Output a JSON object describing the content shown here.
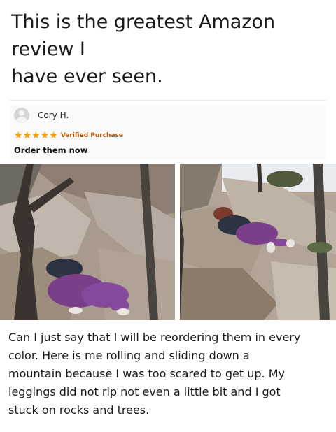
{
  "post": {
    "headline_lines": [
      "This is the greatest Amazon",
      "review I",
      "have ever seen."
    ]
  },
  "review": {
    "reviewer_name": "Cory H.",
    "star_rating": 5,
    "star_color": "#f59e0b",
    "verified_label": "Verified Purchase",
    "title": "Order them now",
    "body_lines": [
      "Can I just say that I will be reordering them in every",
      "color. Here is me rolling and sliding down a",
      "mountain because I was too scared to get up. My",
      "leggings did not rip not even a little bit and I got",
      "stuck on rocks and trees."
    ]
  },
  "photos": [
    "review-photo-left",
    "review-photo-right"
  ],
  "colors": {
    "leggings": "#7b3f8a",
    "rock": "#b8a898",
    "tree": "#3a3330"
  }
}
